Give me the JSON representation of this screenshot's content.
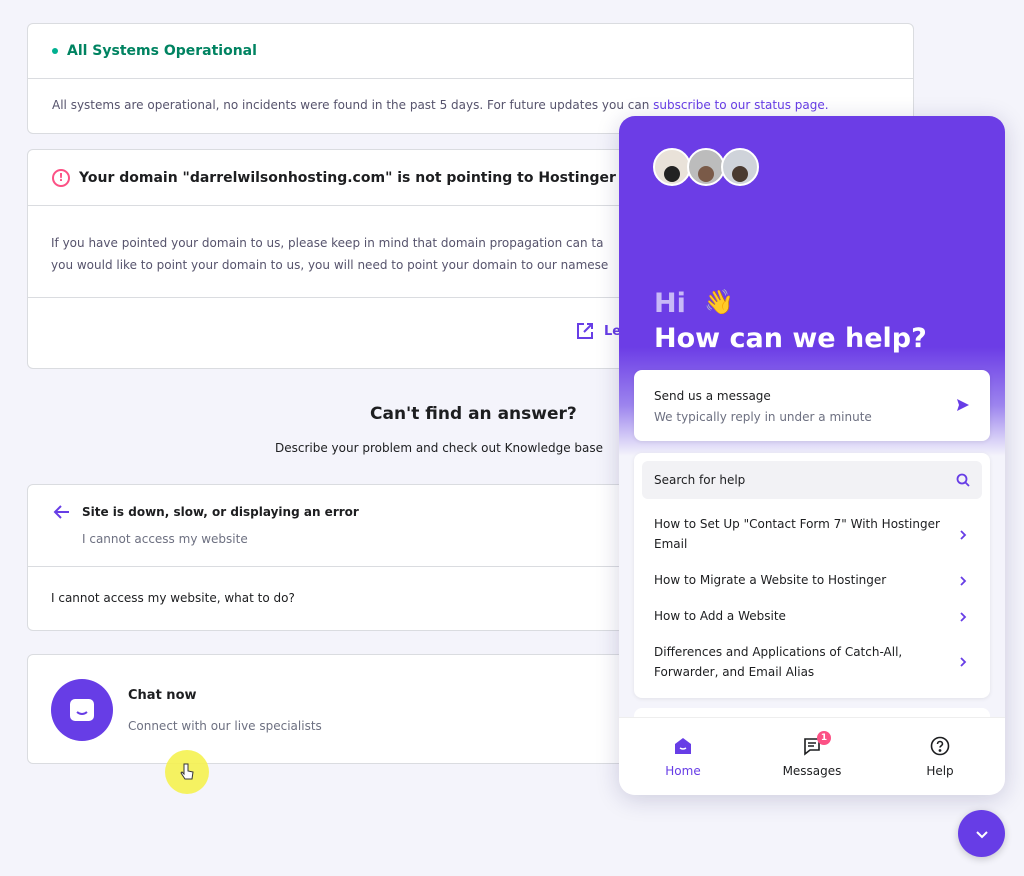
{
  "status": {
    "title": "All Systems Operational",
    "message": "All systems are operational, no incidents were found in the past 5 days. For future updates you can ",
    "link": "subscribe to our status page."
  },
  "domain_alert": {
    "title": "Your domain \"darrelwilsonhosting.com\" is not pointing to Hostinger",
    "line1": "If you have pointed your domain to us, please keep in mind that domain propagation can ta",
    "line2": "you would like to point your domain to us, you will need to point your domain to our namese",
    "learn_link": "Le"
  },
  "help_section": {
    "title": "Can't find an answer?",
    "subtitle": "Describe your problem and check out Knowledge base"
  },
  "site_issue": {
    "title": "Site is down, slow, or displaying an error",
    "subtitle": "I cannot access my website",
    "question": "I cannot access my website, what to do?"
  },
  "chat": {
    "title": "Chat now",
    "subtitle": "Connect with our live specialists"
  },
  "widget": {
    "greeting": "Hi",
    "wave": "👋",
    "headline": "How can we help?",
    "send": {
      "title": "Send us a message",
      "subtitle": "We typically reply in under a minute"
    },
    "search_label": "Search for help",
    "articles": [
      "How to Set Up \"Contact Form 7\" With Hostinger Email",
      "How to Migrate a Website to Hostinger",
      "How to Add a Website",
      "Differences and Applications of Catch-All, Forwarder, and Email Alias"
    ],
    "nav": {
      "home": "Home",
      "messages": "Messages",
      "messages_badge": "1",
      "help": "Help"
    }
  },
  "colors": {
    "accent": "#673de6",
    "success": "#008361",
    "danger": "#fc5185"
  }
}
